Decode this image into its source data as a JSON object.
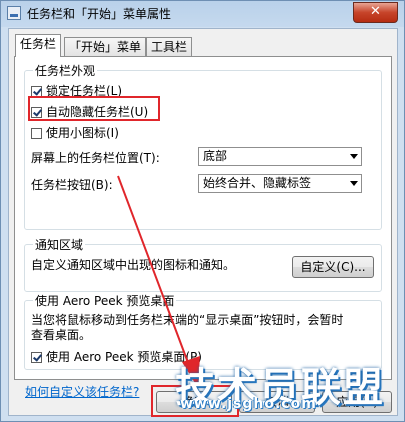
{
  "window": {
    "title": "任务栏和「开始」菜单属性",
    "close_label": "✕"
  },
  "tabs": [
    {
      "label": "任务栏",
      "active": true
    },
    {
      "label": "「开始」菜单",
      "active": false
    },
    {
      "label": "工具栏",
      "active": false
    }
  ],
  "appearance": {
    "group_title": "任务栏外观",
    "lock_label": "锁定任务栏(L)",
    "lock_checked": true,
    "autohide_label": "自动隐藏任务栏(U)",
    "autohide_checked": true,
    "small_icons_label": "使用小图标(I)",
    "small_icons_checked": false,
    "position_label": "屏幕上的任务栏位置(T):",
    "position_value": "底部",
    "buttons_label": "任务栏按钮(B):",
    "buttons_value": "始终合并、隐藏标签"
  },
  "notification": {
    "group_title": "通知区域",
    "description": "自定义通知区域中出现的图标和通知。",
    "customize_button": "自定义(C)..."
  },
  "aero_peek": {
    "group_title": "使用 Aero Peek 预览桌面",
    "description_line1": "当您将鼠标移动到任务栏末端的“显示桌面”按钮时，会暂时",
    "description_line2": "查看桌面。",
    "checkbox_label": "使用 Aero Peek 预览桌面(P)",
    "checked": true
  },
  "help_link": "如何自定义该任务栏?",
  "buttons": {
    "ok": "确定",
    "cancel": "取消",
    "apply": "应用(A)"
  },
  "watermark": {
    "text": "技术员联盟",
    "url": "www.jsgho.com"
  },
  "colors": {
    "highlight": "#e0262b",
    "link": "#0066cc"
  }
}
